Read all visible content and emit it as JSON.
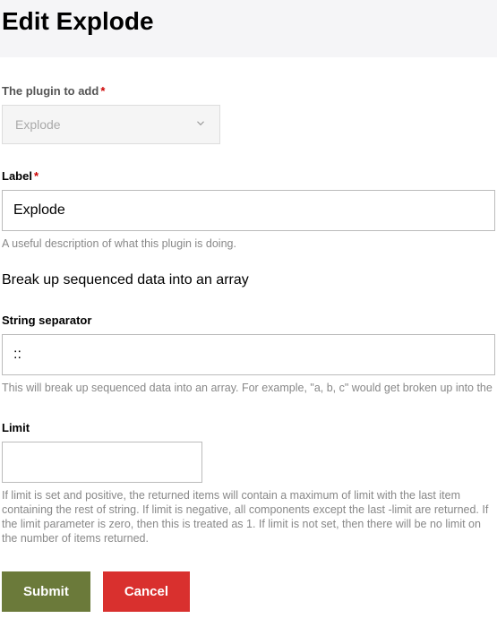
{
  "header": {
    "title": "Edit Explode"
  },
  "form": {
    "plugin": {
      "label": "The plugin to add",
      "required_marker": "*",
      "selected": "Explode"
    },
    "label_field": {
      "label": "Label",
      "required_marker": "*",
      "value": "Explode",
      "help": "A useful description of what this plugin is doing."
    },
    "description": "Break up sequenced data into an array",
    "separator": {
      "label": "String separator",
      "value": "::",
      "help": "This will break up sequenced data into an array. For example, \"a, b, c\" would get broken up into the"
    },
    "limit": {
      "label": "Limit",
      "value": "",
      "help": "If limit is set and positive, the returned items will contain a maximum of limit with the last item containing the rest of string. If limit is negative, all components except the last -limit are returned. If the limit parameter is zero, then this is treated as 1. If limit is not set, then there will be no limit on the number of items returned."
    },
    "buttons": {
      "submit": "Submit",
      "cancel": "Cancel"
    }
  }
}
